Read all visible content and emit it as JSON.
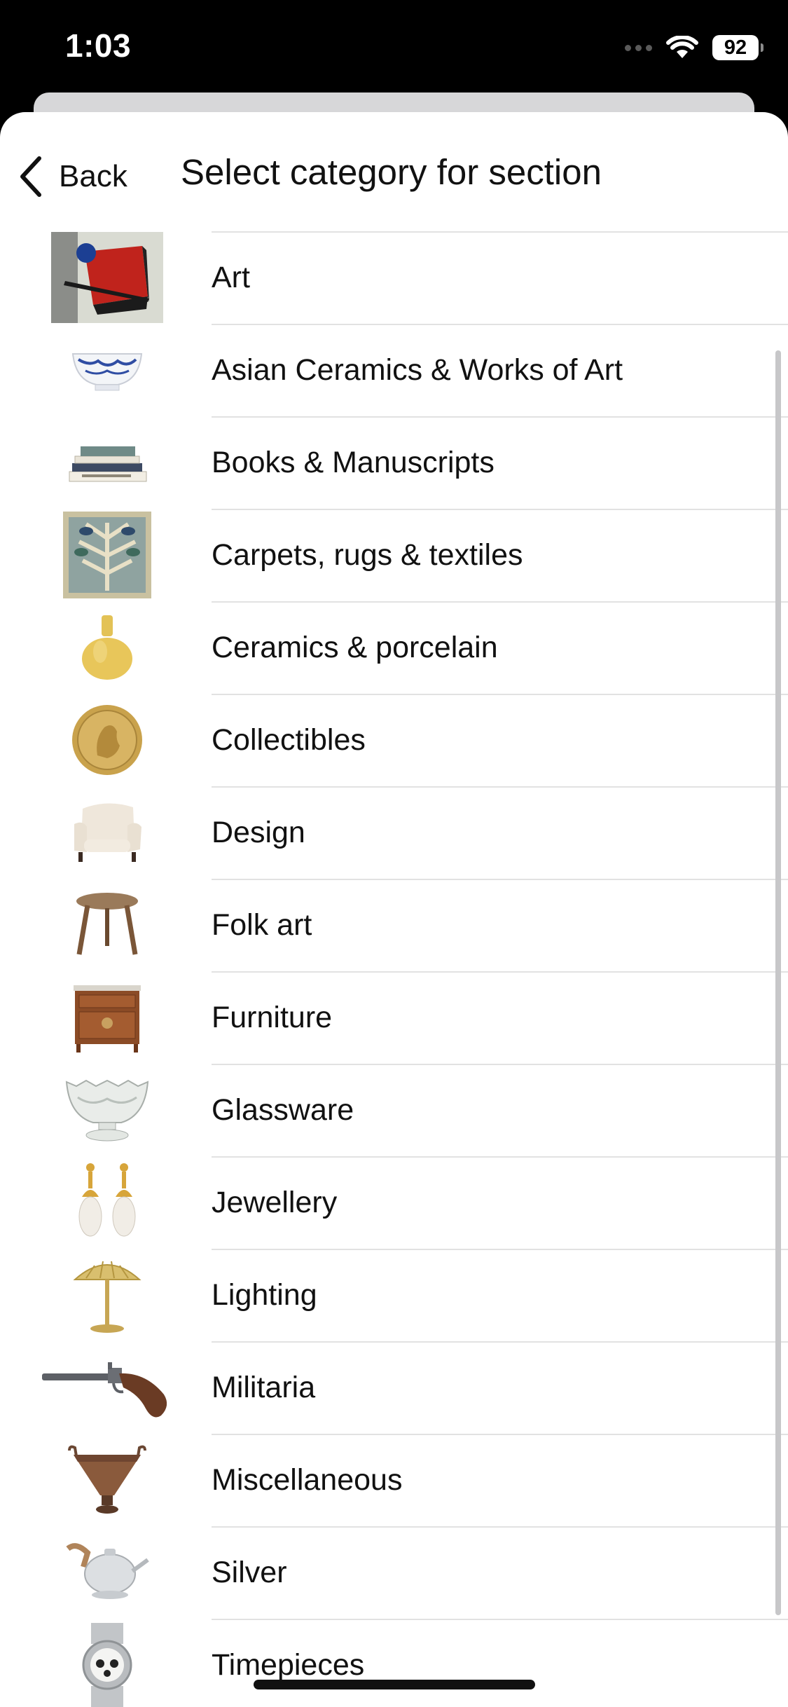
{
  "status_bar": {
    "time": "1:03",
    "battery": "92",
    "icons": [
      "signal-icon",
      "wifi-icon",
      "battery-icon"
    ]
  },
  "nav": {
    "back_label": "Back",
    "title": "Select category for section"
  },
  "categories": [
    {
      "label": "Art",
      "icon": "painting-thumbnail"
    },
    {
      "label": "Asian Ceramics & Works of Art",
      "icon": "bowl-thumbnail"
    },
    {
      "label": "Books & Manuscripts",
      "icon": "books-thumbnail"
    },
    {
      "label": "Carpets, rugs & textiles",
      "icon": "rug-thumbnail"
    },
    {
      "label": "Ceramics & porcelain",
      "icon": "vase-thumbnail"
    },
    {
      "label": "Collectibles",
      "icon": "coin-thumbnail"
    },
    {
      "label": "Design",
      "icon": "armchair-thumbnail"
    },
    {
      "label": "Folk art",
      "icon": "stool-thumbnail"
    },
    {
      "label": "Furniture",
      "icon": "commode-thumbnail"
    },
    {
      "label": "Glassware",
      "icon": "glass-bowl-thumbnail"
    },
    {
      "label": "Jewellery",
      "icon": "earrings-thumbnail"
    },
    {
      "label": "Lighting",
      "icon": "lamp-thumbnail"
    },
    {
      "label": "Militaria",
      "icon": "pistol-thumbnail"
    },
    {
      "label": "Miscellaneous",
      "icon": "urn-thumbnail"
    },
    {
      "label": "Silver",
      "icon": "teapot-thumbnail"
    },
    {
      "label": "Timepieces",
      "icon": "watch-thumbnail"
    }
  ]
}
